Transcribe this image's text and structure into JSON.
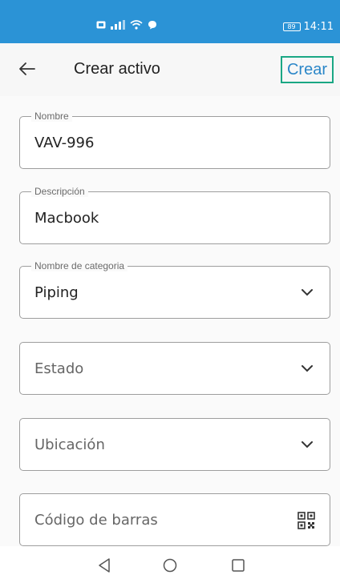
{
  "status_bar": {
    "time": "14:11",
    "battery": "89",
    "icons": [
      "sim-icon",
      "signal-icon",
      "wifi-icon",
      "chat-icon"
    ]
  },
  "app_bar": {
    "title": "Crear activo",
    "create_label": "Crear"
  },
  "form": {
    "nombre": {
      "label": "Nombre",
      "value": "VAV-996"
    },
    "descripcion": {
      "label": "Descripción",
      "value": "Macbook"
    },
    "categoria": {
      "label": "Nombre de categoria",
      "value": "Piping"
    },
    "estado": {
      "placeholder": "Estado"
    },
    "ubicacion": {
      "placeholder": "Ubicación"
    },
    "codigo_barras": {
      "placeholder": "Código de barras"
    }
  },
  "nav_bar": {
    "icons": [
      "back-nav-icon",
      "home-nav-icon",
      "recents-nav-icon"
    ]
  },
  "colors": {
    "status_bar": "#2b93d6",
    "accent_border": "#1aa784",
    "accent_text": "#2a86c8"
  }
}
